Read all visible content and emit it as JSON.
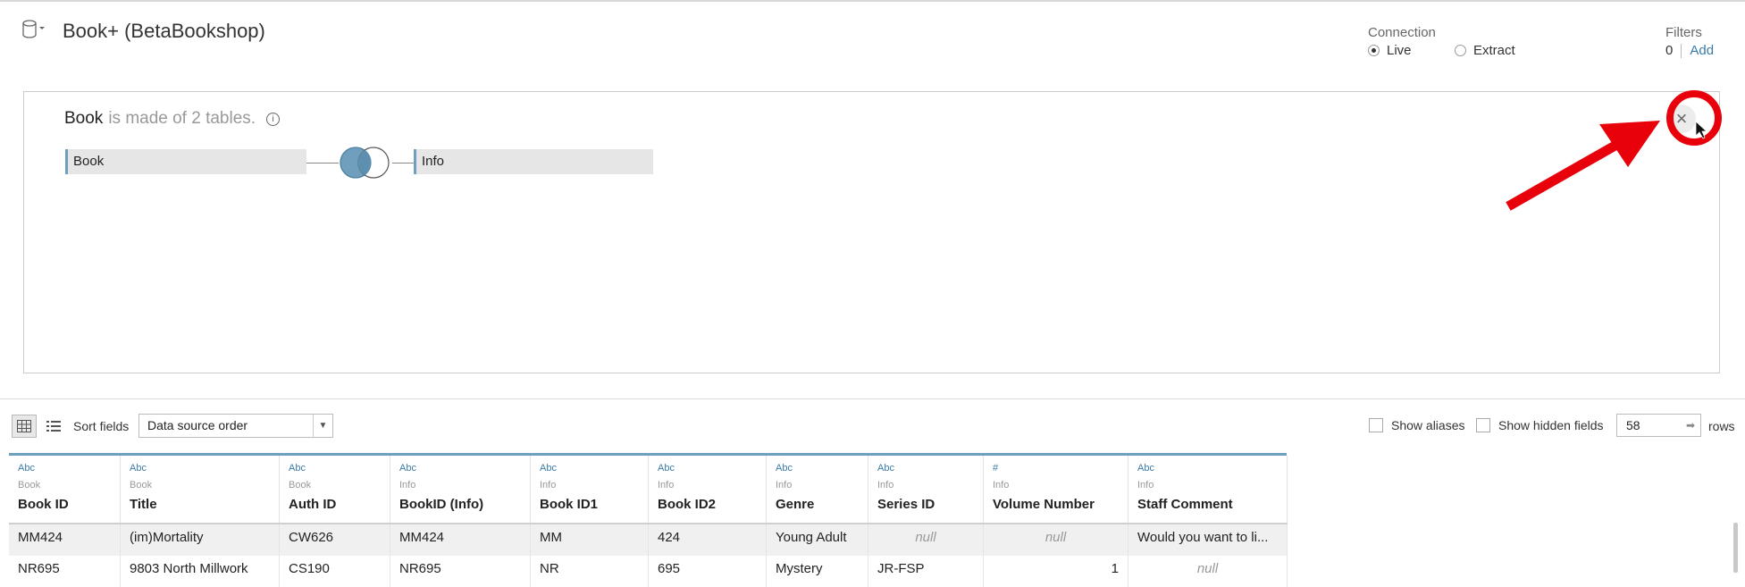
{
  "datasource": {
    "title": "Book+ (BetaBookshop)",
    "icon": "database-icon"
  },
  "connection": {
    "label": "Connection",
    "options": [
      "Live",
      "Extract"
    ],
    "selected": "Live"
  },
  "filters": {
    "label": "Filters",
    "count": "0",
    "add_label": "Add"
  },
  "join_panel": {
    "table_name": "Book",
    "description": "is made of 2 tables.",
    "left_table": "Book",
    "right_table": "Info",
    "join_type": "inner"
  },
  "toolbar": {
    "sort_label": "Sort fields",
    "sort_value": "Data source order",
    "show_aliases": "Show aliases",
    "show_hidden": "Show hidden fields",
    "rows_value": "58",
    "rows_label": "rows"
  },
  "grid": {
    "columns": [
      {
        "type": "Abc",
        "source": "Book",
        "name": "Book ID"
      },
      {
        "type": "Abc",
        "source": "Book",
        "name": "Title"
      },
      {
        "type": "Abc",
        "source": "Book",
        "name": "Auth ID"
      },
      {
        "type": "Abc",
        "source": "Info",
        "name": "BookID (Info)"
      },
      {
        "type": "Abc",
        "source": "Info",
        "name": "Book ID1"
      },
      {
        "type": "Abc",
        "source": "Info",
        "name": "Book ID2"
      },
      {
        "type": "Abc",
        "source": "Info",
        "name": "Genre"
      },
      {
        "type": "Abc",
        "source": "Info",
        "name": "Series ID"
      },
      {
        "type": "#",
        "source": "Info",
        "name": "Volume Number"
      },
      {
        "type": "Abc",
        "source": "Info",
        "name": "Staff Comment"
      }
    ],
    "rows": [
      [
        "MM424",
        "(im)Mortality",
        "CW626",
        "MM424",
        "MM",
        "424",
        "Young Adult",
        "null",
        "null",
        "Would you want to li..."
      ],
      [
        "NR695",
        "9803 North Millwork",
        "CS190",
        "NR695",
        "NR",
        "695",
        "Mystery",
        "JR-FSP",
        "1",
        "null"
      ]
    ]
  },
  "colors": {
    "accent": "#6f9fbd",
    "link": "#3a7ba8",
    "annotation": "#e8000b"
  }
}
